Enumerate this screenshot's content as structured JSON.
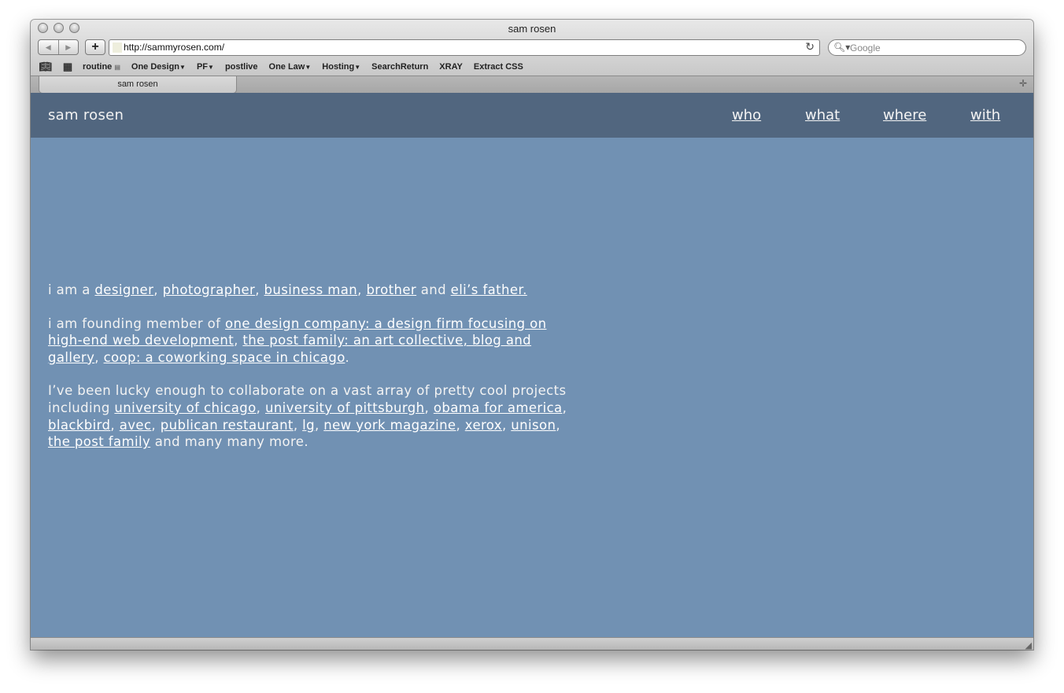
{
  "window": {
    "title": "sam rosen"
  },
  "toolbar": {
    "back_icon": "back-arrow-icon",
    "forward_icon": "forward-arrow-icon",
    "add_label": "+",
    "url": "http://sammyrosen.com/",
    "search_placeholder": "Google"
  },
  "bookmarks": [
    "routine",
    "One Design",
    "PF",
    "postlive",
    "One Law",
    "Hosting",
    "SearchReturn",
    "XRAY",
    "Extract CSS"
  ],
  "tab": {
    "label": "sam rosen"
  },
  "site": {
    "brand": "sam rosen",
    "nav": [
      "who",
      "what",
      "where",
      "with"
    ]
  },
  "content": {
    "p1": {
      "lead": "i am a ",
      "designer": "designer",
      "photographer": "photographer",
      "business_man": "business man",
      "brother": "brother",
      "and": " and ",
      "father": "eli’s father."
    },
    "p2": {
      "lead": "i am founding member of ",
      "one_design": "one design company: a design firm focusing on high-end web development",
      "post_family": "the post family: an art collective, blog and gallery",
      "coop": "coop: a coworking space in chicago",
      "end": "."
    },
    "p3": {
      "lead": "I’ve been lucky enough to collaborate on a vast array of pretty cool projects including ",
      "links": [
        "university of chicago",
        "university of pittsburgh",
        "obama for america",
        "blackbird",
        "avec",
        "publican restaurant",
        "lg",
        "new york magazine",
        "xerox",
        "unison",
        "the post family"
      ],
      "end": " and many many more."
    }
  },
  "colors": {
    "header": "#51667f",
    "page": "#7191b3",
    "text": "#f3f3f3"
  }
}
